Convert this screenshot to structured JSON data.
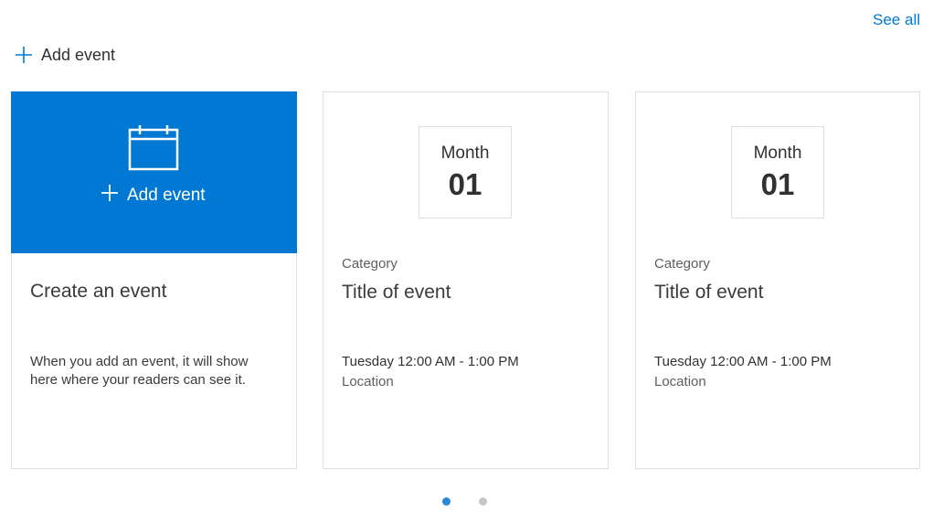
{
  "header": {
    "see_all_label": "See all",
    "add_event_label": "Add event",
    "add_icon": "plus-icon"
  },
  "create_card": {
    "hero_icon": "calendar-icon",
    "hero_add_label": "Add event",
    "title": "Create an event",
    "description": "When you add an event, it will show here where your readers can see it."
  },
  "events": [
    {
      "month": "Month",
      "day": "01",
      "category": "Category",
      "title": "Title of event",
      "time": "Tuesday 12:00 AM - 1:00 PM",
      "location": "Location"
    },
    {
      "month": "Month",
      "day": "01",
      "category": "Category",
      "title": "Title of event",
      "time": "Tuesday 12:00 AM - 1:00 PM",
      "location": "Location"
    }
  ],
  "pagination": {
    "pages": 2,
    "active_index": 0,
    "active_color": "#2b88d8",
    "inactive_color": "#c8c6c4"
  },
  "colors": {
    "accent": "#0078d4",
    "border": "#e1dfdd"
  }
}
